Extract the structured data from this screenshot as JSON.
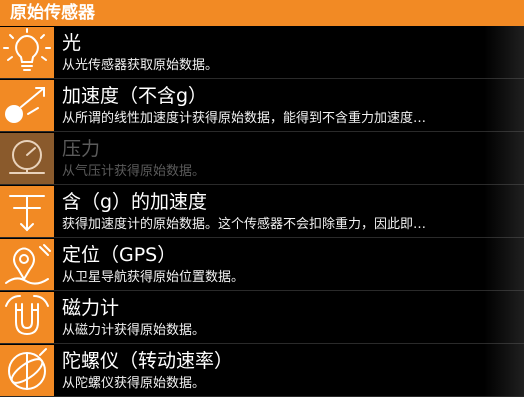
{
  "header": {
    "title": "原始传感器"
  },
  "colors": {
    "accent": "#f28a24",
    "background": "#000000",
    "disabled_text": "#5b5b5b"
  },
  "sensors": [
    {
      "title": "光",
      "desc": "从光传感器获取原始数据。",
      "icon": "lightbulb-icon",
      "enabled": true
    },
    {
      "title": "加速度（不含g）",
      "desc": "从所谓的线性加速度计获得原始数据，能得到不含重力加速度…",
      "icon": "acceleration-icon",
      "enabled": true
    },
    {
      "title": "压力",
      "desc": "从气压计获得原始数据。",
      "icon": "pressure-gauge-icon",
      "enabled": false
    },
    {
      "title": "含（g）的加速度",
      "desc": "获得加速度计的原始数据。这个传感器不会扣除重力，因此即…",
      "icon": "gravity-arrow-icon",
      "enabled": true
    },
    {
      "title": "定位（GPS）",
      "desc": "从卫星导航获得原始位置数据。",
      "icon": "gps-pin-icon",
      "enabled": true
    },
    {
      "title": "磁力计",
      "desc": "从磁力计获得原始数据。",
      "icon": "magnet-icon",
      "enabled": true
    },
    {
      "title": "陀螺仪（转动速率）",
      "desc": "从陀螺仪获得原始数据。",
      "icon": "gyroscope-icon",
      "enabled": true
    }
  ]
}
